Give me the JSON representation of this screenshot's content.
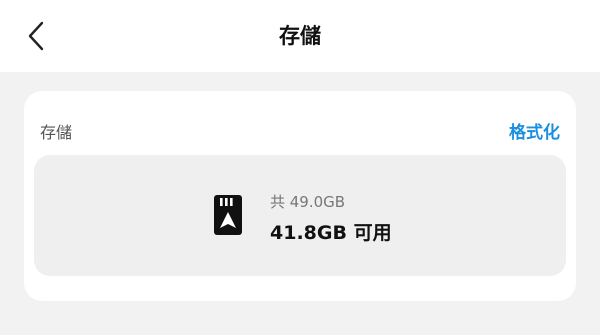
{
  "header": {
    "title": "存儲",
    "back_icon": "chevron-left-icon"
  },
  "storage_card": {
    "label": "存儲",
    "format_label": "格式化",
    "accent_color": "#1a8fe0",
    "sd_card_icon": "sd-card-icon",
    "total_text": "共 49.0GB",
    "available_text": "41.8GB 可用"
  }
}
